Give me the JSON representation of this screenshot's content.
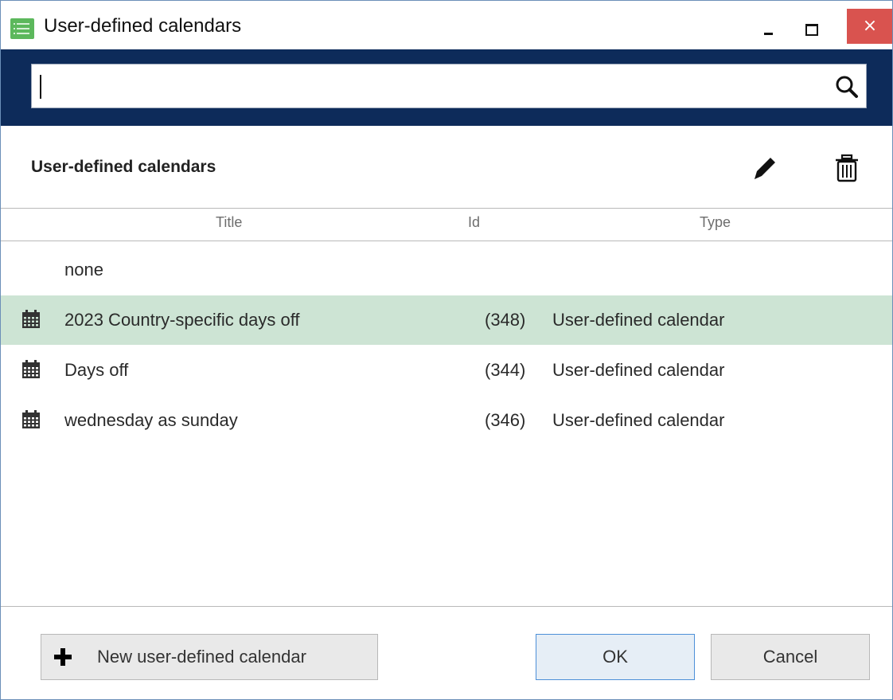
{
  "window": {
    "title": "User-defined calendars",
    "controls": {
      "minimize": "minimize",
      "maximize": "maximize",
      "close": "×"
    }
  },
  "search": {
    "placeholder": "",
    "value": ""
  },
  "section": {
    "title": "User-defined calendars"
  },
  "table": {
    "columns": [
      "Title",
      "Id",
      "Type"
    ],
    "rows": [
      {
        "title": "none",
        "id": "",
        "type": "",
        "icon": "none",
        "selected": false
      },
      {
        "title": "2023 Country-specific days off",
        "id": "(348)",
        "type": "User-defined calendar",
        "icon": "calendar-icon",
        "selected": true
      },
      {
        "title": "Days off",
        "id": "(344)",
        "type": "User-defined calendar",
        "icon": "calendar-icon",
        "selected": false
      },
      {
        "title": "wednesday as sunday",
        "id": "(346)",
        "type": "User-defined calendar",
        "icon": "calendar-icon",
        "selected": false
      }
    ]
  },
  "footer": {
    "new_label": "New user-defined calendar",
    "ok_label": "OK",
    "cancel_label": "Cancel"
  },
  "colors": {
    "search_band": "#0d2b5a",
    "selected_row": "#cde4d4",
    "close_button": "#d9534f",
    "app_icon": "#5cb85c"
  }
}
